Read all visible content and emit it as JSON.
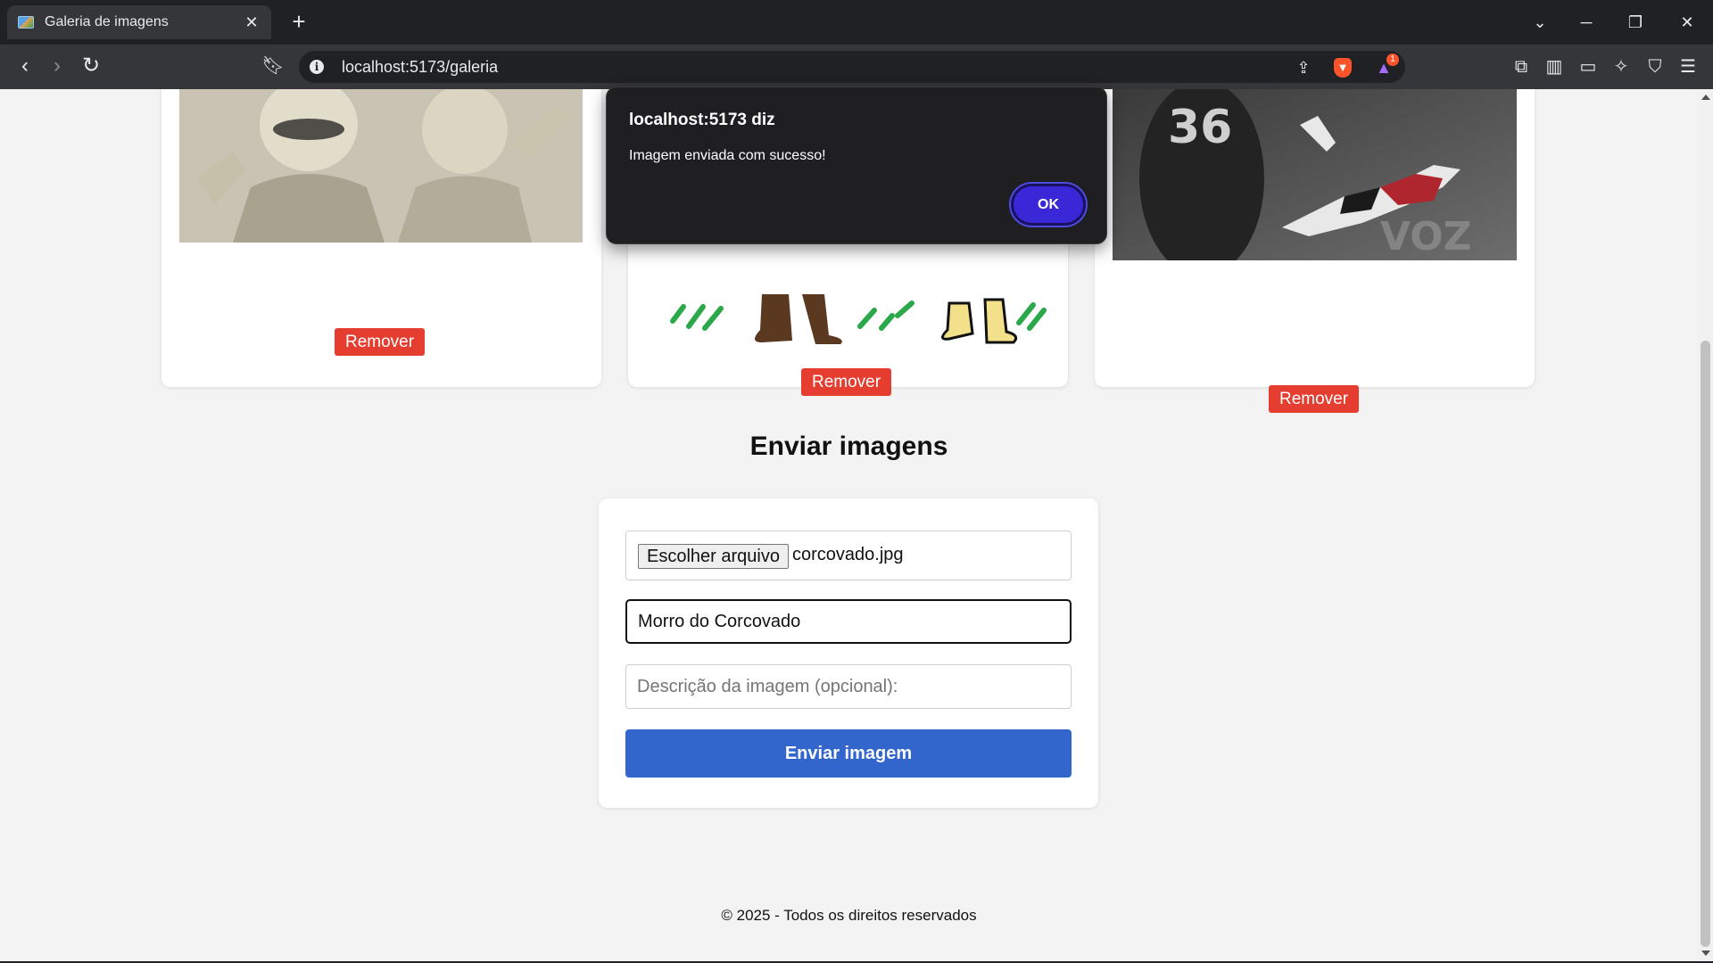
{
  "browser": {
    "tab_title": "Galeria de imagens",
    "url": "localhost:5173/galeria",
    "rewards_badge": "1"
  },
  "gallery": {
    "remove_label": "Remover"
  },
  "upload": {
    "section_title": "Enviar imagens",
    "file_button": "Escolher arquivo",
    "file_name": "corcovado.jpg",
    "title_value": "Morro do Corcovado",
    "description_placeholder": "Descrição da imagem (opcional):",
    "submit_label": "Enviar imagem"
  },
  "footer": {
    "text": "© 2025 - Todos os direitos reservados"
  },
  "alert": {
    "title": "localhost:5173 diz",
    "message": "Imagem enviada com sucesso!",
    "ok_label": "OK"
  },
  "colors": {
    "remove_button": "#e53e30",
    "submit_button": "#3366cc",
    "dialog_ok": "#3a28d8"
  }
}
